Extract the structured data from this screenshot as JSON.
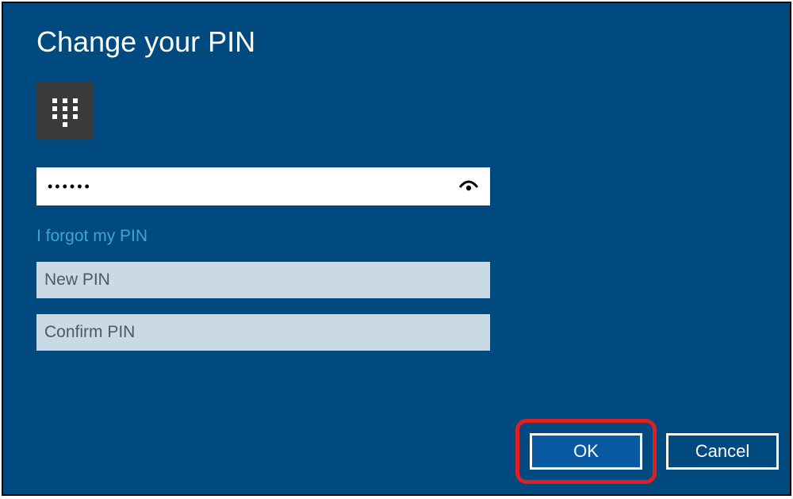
{
  "title": "Change your PIN",
  "current_pin": {
    "masked_value": "••••••"
  },
  "forgot_link": "I forgot my PIN",
  "new_pin_placeholder": "New PIN",
  "confirm_pin_placeholder": "Confirm PIN",
  "buttons": {
    "ok": "OK",
    "cancel": "Cancel"
  },
  "colors": {
    "background": "#004a7f",
    "highlight": "#e02020",
    "button_primary": "#0a5aa3",
    "link": "#3ea4d6",
    "placeholder_bg": "#cad9e6"
  }
}
